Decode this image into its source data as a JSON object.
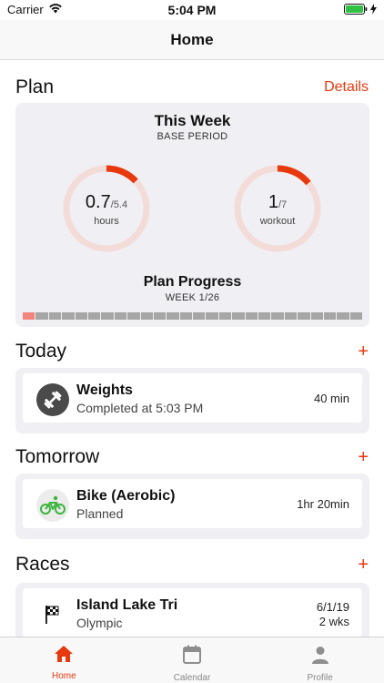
{
  "status": {
    "carrier": "Carrier",
    "time": "5:04 PM"
  },
  "nav": {
    "title": "Home"
  },
  "plan": {
    "title": "Plan",
    "details_label": "Details",
    "week_title": "This Week",
    "week_sub": "BASE PERIOD",
    "hours_value": "0.7",
    "hours_total": "/5.4",
    "hours_label": "hours",
    "hours_fraction": 0.13,
    "workout_value": "1",
    "workout_total": "/7",
    "workout_label": "workout",
    "workout_fraction": 0.14,
    "progress_title": "Plan Progress",
    "progress_sub": "WEEK 1/26",
    "progress_weeks_total": 26,
    "progress_weeks_done": 1
  },
  "today": {
    "title": "Today",
    "add_label": "+",
    "items": [
      {
        "title": "Weights",
        "sub": "Completed at 5:03 PM",
        "right": "40 min",
        "icon": "dumbbell-icon"
      }
    ]
  },
  "tomorrow": {
    "title": "Tomorrow",
    "add_label": "+",
    "items": [
      {
        "title": "Bike (Aerobic)",
        "sub": "Planned",
        "right": "1hr 20min",
        "icon": "bike-icon"
      }
    ]
  },
  "races": {
    "title": "Races",
    "add_label": "+",
    "items": [
      {
        "title": "Island Lake Tri",
        "sub": "Olympic",
        "right_date": "6/1/19",
        "right_eta": "2 wks",
        "icon": "checkered-flag-icon"
      }
    ]
  },
  "tabs": [
    {
      "label": "Home",
      "icon": "home-icon",
      "active": true
    },
    {
      "label": "Calendar",
      "icon": "calendar-icon",
      "active": false
    },
    {
      "label": "Profile",
      "icon": "person-icon",
      "active": false
    }
  ],
  "colors": {
    "accent": "#e8380d",
    "ring_track": "#f3dcd8",
    "card_bg": "#efeff4",
    "bike_green": "#3cb43c"
  }
}
